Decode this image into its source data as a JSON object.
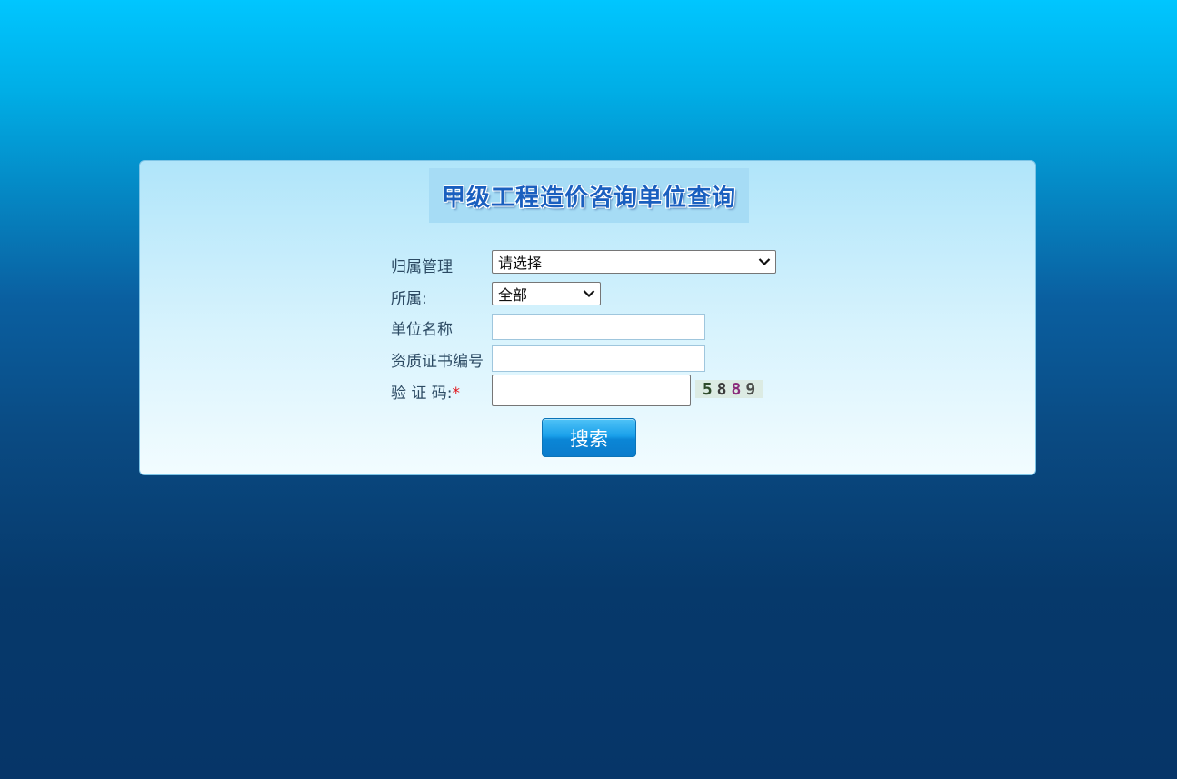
{
  "title": "甲级工程造价咨询单位查询",
  "form": {
    "management_label": "归属管理",
    "management_selected": "请选择",
    "affiliation_label": "所属:",
    "affiliation_selected": "全部",
    "unit_name_label": "单位名称",
    "unit_name_value": "",
    "cert_no_label": "资质证书编号",
    "cert_no_value": "",
    "captcha_label": "验 证 码:",
    "captcha_required": "*",
    "captcha_value": "",
    "captcha_digits": [
      "5",
      "8",
      "8",
      "9"
    ]
  },
  "search_button": "搜索",
  "colors": {
    "label": "#2c4a63",
    "required": "#e0161b",
    "title": "#1a5fbf",
    "button": "#0b86d6"
  }
}
